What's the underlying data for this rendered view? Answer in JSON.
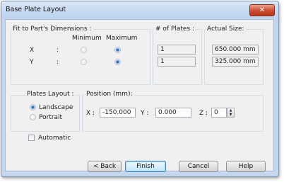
{
  "window": {
    "title": "Base Plate Layout",
    "close_glyph": "✕"
  },
  "fit": {
    "group_label": "Fit to Part's Dimensions :",
    "min_header": "Minimum",
    "max_header": "Maximum",
    "rows": [
      {
        "axis": "X",
        "sep": ":",
        "selected": "Maximum"
      },
      {
        "axis": "Y",
        "sep": ":",
        "selected": "Maximum"
      }
    ]
  },
  "plates": {
    "label": "# of Plates :",
    "x_value": "1",
    "y_value": "1"
  },
  "actual_size": {
    "label": "Actual Size:",
    "x_value": "650.000 mm",
    "y_value": "325.000 mm"
  },
  "layout": {
    "group_label": "Plates Layout :",
    "options": [
      "Landscape",
      "Portrait"
    ],
    "selected": "Landscape"
  },
  "position": {
    "group_label": "Position (mm):",
    "x_label": "X :",
    "x_value": "-150.000",
    "y_label": "Y :",
    "y_value": "0.000",
    "z_label": "Z :",
    "z_value": "0"
  },
  "automatic": {
    "label": "Automatic",
    "checked": false
  },
  "buttons": {
    "back": "< Back",
    "finish": "Finish",
    "cancel": "Cancel",
    "help": "Help"
  },
  "icons": [
    "close-icon",
    "spin-up-icon",
    "spin-down-icon"
  ],
  "colors": {
    "title_bar": "#c4d7ef",
    "close_button": "#c94a2c",
    "radio_selected": "#2f6fc0"
  }
}
